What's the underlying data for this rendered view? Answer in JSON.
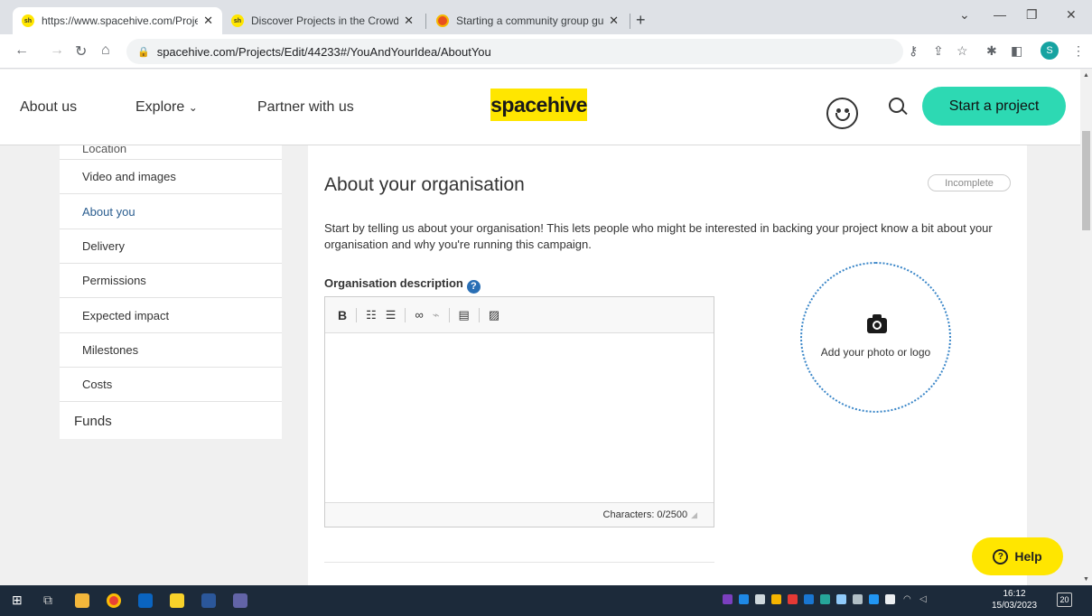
{
  "browser": {
    "tabs": [
      {
        "title": "https://www.spacehive.com/Proje",
        "favicon": "sh"
      },
      {
        "title": "Discover Projects in the Crowdfu",
        "favicon": "sh"
      },
      {
        "title": "Starting a community group guid",
        "favicon": ""
      }
    ],
    "url": "spacehive.com/Projects/Edit/44233#/YouAndYourIdea/AboutYou",
    "profile_initial": "S"
  },
  "header": {
    "nav": [
      "About us",
      "Explore",
      "Partner with us"
    ],
    "logo": "spacehive",
    "start_label": "Start a project"
  },
  "sidebar": {
    "cut_item": "Location",
    "items": [
      {
        "label": "Video and images"
      },
      {
        "label": "About you"
      },
      {
        "label": "Delivery"
      },
      {
        "label": "Permissions"
      },
      {
        "label": "Expected impact"
      },
      {
        "label": "Milestones"
      },
      {
        "label": "Costs"
      }
    ],
    "funds": "Funds"
  },
  "main": {
    "title": "About your organisation",
    "status": "Incomplete",
    "intro": "Start by telling us about your organisation! This lets people who might be interested in backing your project know a bit about your organisation and why you're running this campaign.",
    "field_label": "Organisation description",
    "char_count": "Characters: 0/2500",
    "photo_label": "Add your photo or logo"
  },
  "help_label": "Help",
  "taskbar": {
    "time": "16:12",
    "date": "15/03/2023",
    "notif_count": "20"
  },
  "colors": {
    "accent_green": "#2dd9b3",
    "brand_yellow": "#ffe600",
    "link_blue": "#2a5d8f"
  }
}
